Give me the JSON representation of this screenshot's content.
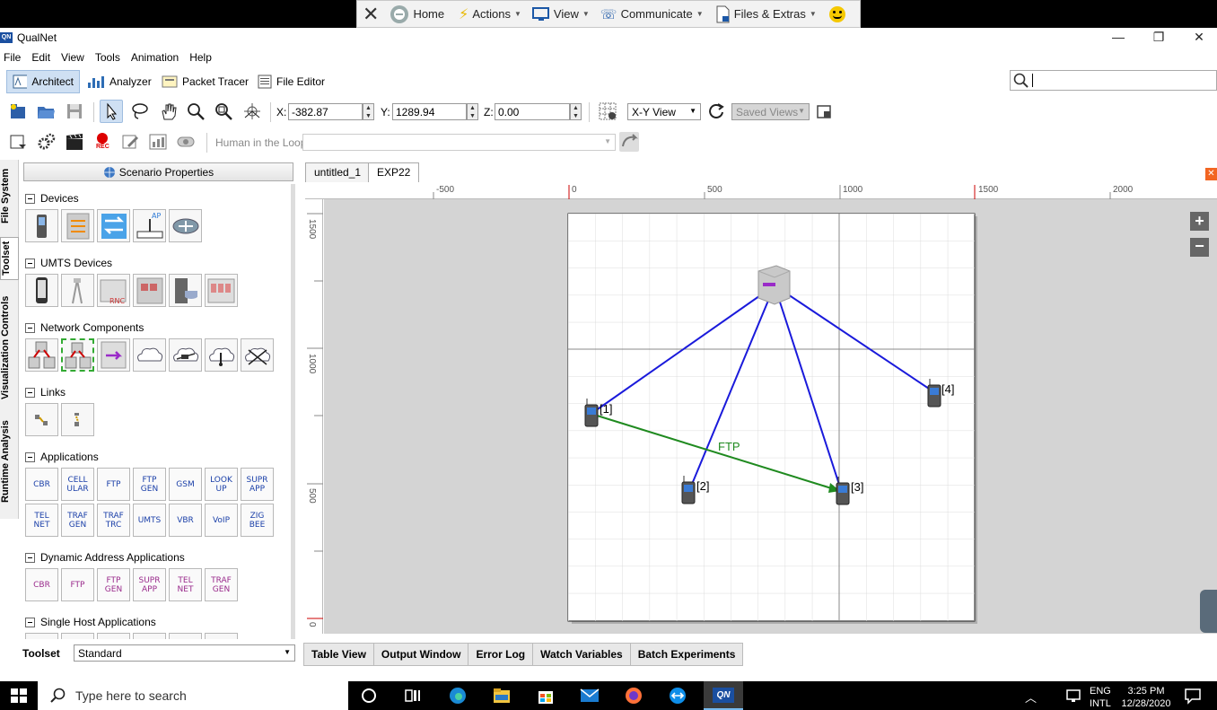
{
  "teamviewer": {
    "home": "Home",
    "actions": "Actions",
    "view": "View",
    "communicate": "Communicate",
    "files_extras": "Files & Extras"
  },
  "app": {
    "logo": "QN",
    "title": "QualNet"
  },
  "menu": [
    "File",
    "Edit",
    "View",
    "Tools",
    "Animation",
    "Help"
  ],
  "modes": [
    "Architect",
    "Analyzer",
    "Packet Tracer",
    "File Editor"
  ],
  "search": {
    "value": ""
  },
  "coords": {
    "x_label": "X:",
    "x_value": "-382.87",
    "y_label": "Y:",
    "y_value": "1289.94",
    "z_label": "Z:",
    "z_value": "0.00",
    "view_select": "X-Y View",
    "saved_views": "Saved Views"
  },
  "toolbar2": {
    "rec_label": "REC",
    "hitl_label": "Human in the Loop:",
    "hitl_value": ""
  },
  "side_tabs": [
    "File System",
    "Toolset",
    "Visualization Controls",
    "Runtime Analysis"
  ],
  "toolset": {
    "scenario_properties": "Scenario Properties",
    "sections": {
      "devices": "Devices",
      "umts_devices": "UMTS Devices",
      "network_components": "Network Components",
      "links": "Links",
      "applications": "Applications",
      "dynamic_apps": "Dynamic Address Applications",
      "single_host": "Single Host Applications"
    },
    "device_tile_labels": {
      "ap": "AP",
      "rnc": "RNC"
    },
    "applications": [
      "CBR",
      "CELL\nULAR",
      "FTP",
      "FTP\nGEN",
      "GSM",
      "LOOK\nUP",
      "SUPR\nAPP",
      "TEL\nNET",
      "TRAF\nGEN",
      "TRAF\nTRC",
      "UMTS",
      "VBR",
      "VoIP",
      "ZIG\nBEE"
    ],
    "dynamic_applications": [
      "CBR",
      "FTP",
      "FTP\nGEN",
      "SUPR\nAPP",
      "TEL\nNET",
      "TRAF\nGEN"
    ],
    "toolset_label": "Toolset",
    "toolset_value": "Standard"
  },
  "doc_tabs": [
    "untitled_1",
    "EXP22"
  ],
  "ruler": {
    "h_ticks": [
      "-500",
      "0",
      "500",
      "1000",
      "1500",
      "2000"
    ],
    "v_ticks": [
      "1500",
      "1000",
      "500",
      "0"
    ]
  },
  "scenario": {
    "nodes": [
      {
        "label": "[1]"
      },
      {
        "label": "[2]"
      },
      {
        "label": "[3]"
      },
      {
        "label": "[4]"
      }
    ],
    "app_link_label": "FTP",
    "colors": {
      "wireless_link": "#1a1adb",
      "app_link": "#1f8a1f",
      "grid": "#dcdcdc",
      "accent": "#3d78c4"
    }
  },
  "bottom_tabs": [
    "Table View",
    "Output Window",
    "Error Log",
    "Watch Variables",
    "Batch Experiments"
  ],
  "taskbar": {
    "search_placeholder": "Type here to search",
    "qualnet_icon": "QN",
    "lang_top": "ENG",
    "lang_bottom": "INTL",
    "time": "3:25 PM",
    "date": "12/28/2020"
  }
}
